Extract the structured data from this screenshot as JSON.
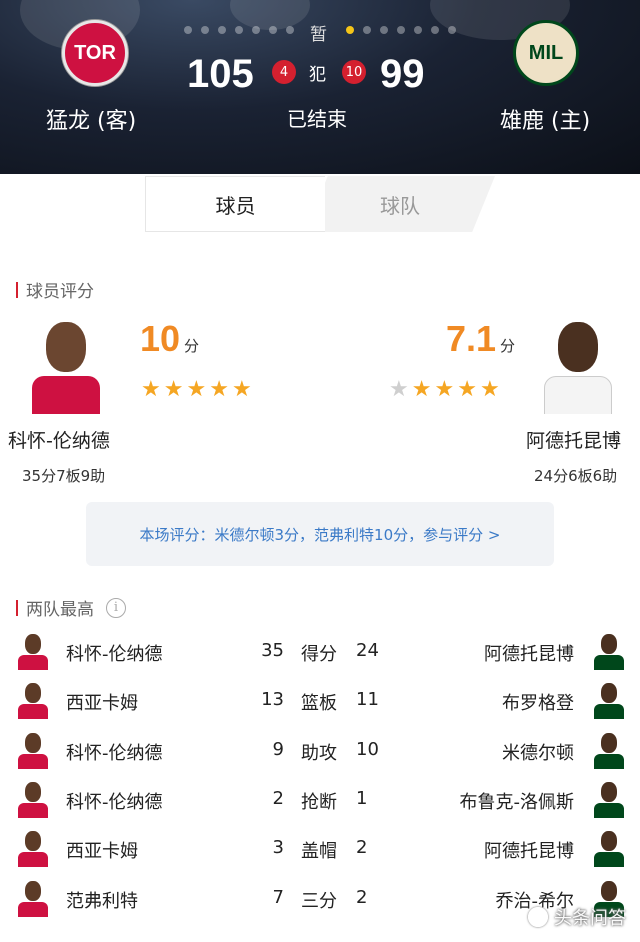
{
  "header": {
    "paused_label": "暂",
    "away": {
      "abbr": "TOR",
      "name": "猛龙 (客)",
      "score": "105",
      "fouls": "4",
      "color": "#ce1141"
    },
    "home": {
      "abbr": "MIL",
      "name": "雄鹿 (主)",
      "score": "99",
      "fouls": "10",
      "color": "#00471b"
    },
    "foul_label": "犯",
    "status": "已结束"
  },
  "tabs": {
    "players": "球员",
    "teams": "球队"
  },
  "rating_section": {
    "title": "球员评分",
    "left": {
      "rating": "10",
      "unit": "分",
      "stars_filled": 5,
      "stars_total": 5,
      "name": "科怀-伦纳德",
      "stat": "35分7板9助"
    },
    "right": {
      "rating": "7.1",
      "unit": "分",
      "stars_filled": 4,
      "stars_total": 5,
      "name": "阿德托昆博",
      "stat": "24分6板6助"
    },
    "vote_text": "本场评分：米德尔顿3分，范弗利特10分，参与评分 >"
  },
  "leaders_section": {
    "title": "两队最高",
    "rows": [
      {
        "left_name": "科怀-伦纳德",
        "left_value": "35",
        "category": "得分",
        "right_value": "24",
        "right_name": "阿德托昆博"
      },
      {
        "left_name": "西亚卡姆",
        "left_value": "13",
        "category": "篮板",
        "right_value": "11",
        "right_name": "布罗格登"
      },
      {
        "left_name": "科怀-伦纳德",
        "left_value": "9",
        "category": "助攻",
        "right_value": "10",
        "right_name": "米德尔顿"
      },
      {
        "left_name": "科怀-伦纳德",
        "left_value": "2",
        "category": "抢断",
        "right_value": "1",
        "right_name": "布鲁克-洛佩斯"
      },
      {
        "left_name": "西亚卡姆",
        "left_value": "3",
        "category": "盖帽",
        "right_value": "2",
        "right_name": "阿德托昆博"
      },
      {
        "left_name": "范弗利特",
        "left_value": "7",
        "category": "三分",
        "right_value": "2",
        "right_name": "乔治-希尔"
      }
    ]
  },
  "watermark": "头条问答",
  "colors": {
    "accent": "#f08a24",
    "star": "#f5a623",
    "link": "#3b7ac7",
    "foul_badge": "#d4202f"
  }
}
